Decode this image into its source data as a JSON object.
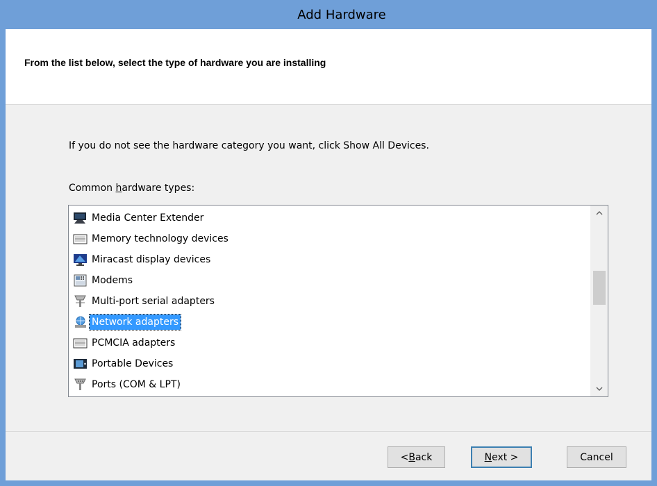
{
  "window": {
    "title": "Add Hardware"
  },
  "header": {
    "instruction": "From the list below, select the type of hardware you are installing"
  },
  "content": {
    "info_text": "If you do not see the hardware category you want, click Show All Devices.",
    "list_label_prefix": "Common ",
    "list_label_accel": "h",
    "list_label_suffix": "ardware types:",
    "items": [
      {
        "label": "Media Center Extender",
        "icon": "media-center-extender-icon",
        "selected": false
      },
      {
        "label": "Memory technology devices",
        "icon": "memory-device-icon",
        "selected": false
      },
      {
        "label": "Miracast display devices",
        "icon": "miracast-display-icon",
        "selected": false
      },
      {
        "label": "Modems",
        "icon": "modem-icon",
        "selected": false
      },
      {
        "label": "Multi-port serial adapters",
        "icon": "serial-port-icon",
        "selected": false
      },
      {
        "label": "Network adapters",
        "icon": "network-adapter-icon",
        "selected": true
      },
      {
        "label": "PCMCIA adapters",
        "icon": "pcmcia-icon",
        "selected": false
      },
      {
        "label": "Portable Devices",
        "icon": "portable-device-icon",
        "selected": false
      },
      {
        "label": "Ports (COM & LPT)",
        "icon": "ports-icon",
        "selected": false
      }
    ]
  },
  "buttons": {
    "back_accel": "B",
    "back_rest": "ack",
    "back_prefix": "< ",
    "next_accel": "N",
    "next_rest": "ext >",
    "cancel": "Cancel"
  },
  "colors": {
    "frame": "#6f9fd8",
    "selection": "#3399ff",
    "dialog_bg": "#f0f0f0"
  }
}
